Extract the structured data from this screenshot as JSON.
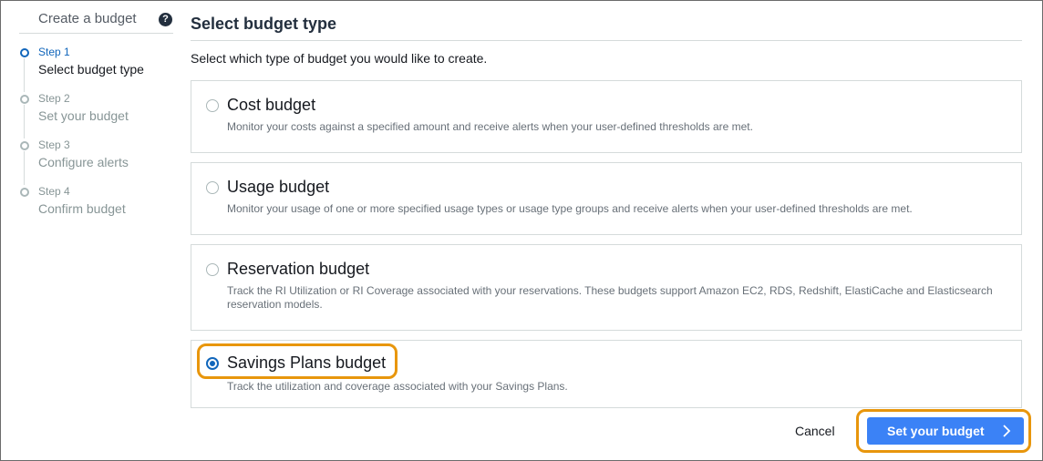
{
  "sidebar": {
    "title": "Create a budget",
    "help_icon": "help-circle-icon",
    "steps": [
      {
        "num": "Step 1",
        "label": "Select budget type",
        "active": true
      },
      {
        "num": "Step 2",
        "label": "Set your budget",
        "active": false
      },
      {
        "num": "Step 3",
        "label": "Configure alerts",
        "active": false
      },
      {
        "num": "Step 4",
        "label": "Confirm budget",
        "active": false
      }
    ]
  },
  "main": {
    "title": "Select budget type",
    "intro": "Select which type of budget you would like to create.",
    "options": [
      {
        "title": "Cost budget",
        "description": "Monitor your costs against a specified amount and receive alerts when your user-defined thresholds are met.",
        "selected": false
      },
      {
        "title": "Usage budget",
        "description": "Monitor your usage of one or more specified usage types or usage type groups and receive alerts when your user-defined thresholds are met.",
        "selected": false
      },
      {
        "title": "Reservation budget",
        "description": "Track the RI Utilization or RI Coverage associated with your reservations. These budgets support Amazon EC2, RDS, Redshift, ElastiCache and Elasticsearch reservation models.",
        "selected": false
      },
      {
        "title": "Savings Plans budget",
        "description": "Track the utilization and coverage associated with your Savings Plans.",
        "selected": true
      }
    ]
  },
  "footer": {
    "cancel_label": "Cancel",
    "next_label": "Set your budget",
    "next_icon": "chevron-right-icon"
  },
  "colors": {
    "accent": "#1166bb",
    "primary_button": "#3b82f6",
    "highlight": "#e8960c"
  }
}
